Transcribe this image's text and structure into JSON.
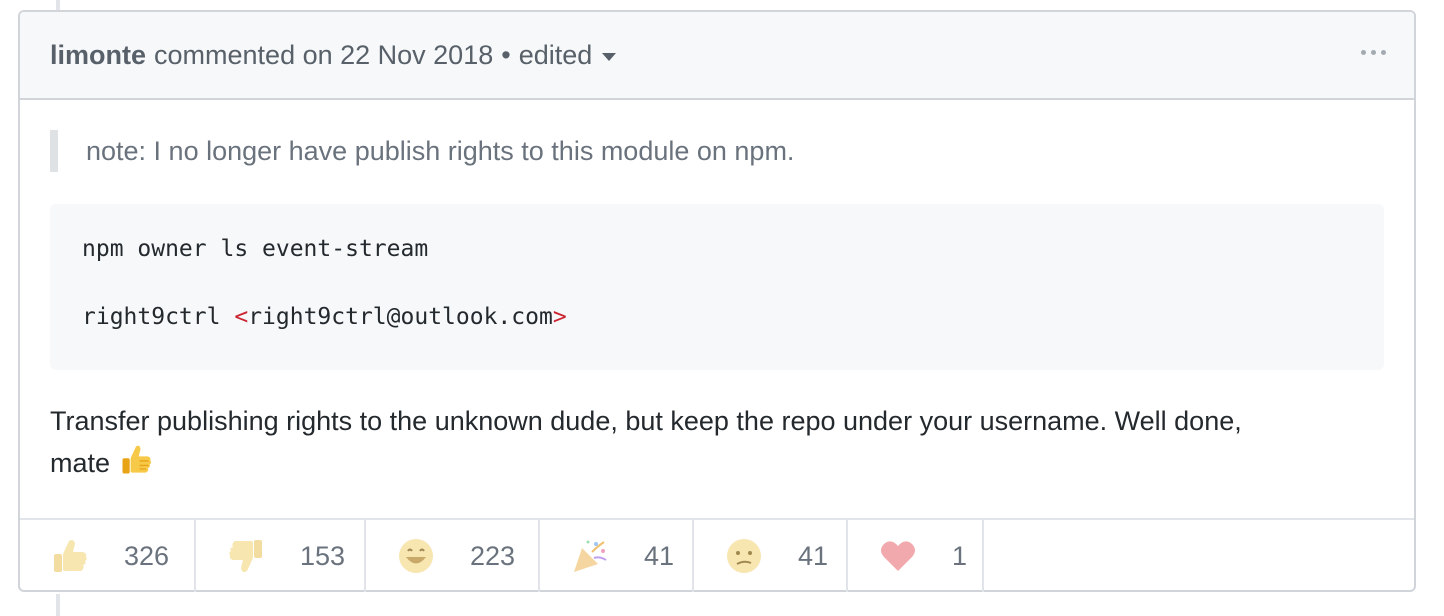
{
  "comment": {
    "author": "limonte",
    "action": "commented on 22 Nov 2018",
    "bullet": "•",
    "edited_label": "edited"
  },
  "body": {
    "quote": "note: I no longer have publish rights to this module on npm.",
    "code_line1": "npm owner ls event-stream",
    "code_line2_user": "right9ctrl ",
    "code_line2_lt": "<",
    "code_line2_email": "right9ctrl@outlook.com",
    "code_line2_gt": ">",
    "paragraph_line1": "Transfer publishing rights to the unknown dude, but keep the repo under your username. Well done,",
    "paragraph_line2": "mate"
  },
  "reactions": [
    {
      "icon": "thumbs-up",
      "count": "326"
    },
    {
      "icon": "thumbs-down",
      "count": "153"
    },
    {
      "icon": "laugh",
      "count": "223"
    },
    {
      "icon": "hooray",
      "count": "41"
    },
    {
      "icon": "confused",
      "count": "41"
    },
    {
      "icon": "heart",
      "count": "1"
    }
  ],
  "colors": {
    "header_bg": "#f6f8fa",
    "border": "#d1d5da",
    "code_punct": "#cb2431",
    "emoji_yellow": "#f7c948"
  }
}
